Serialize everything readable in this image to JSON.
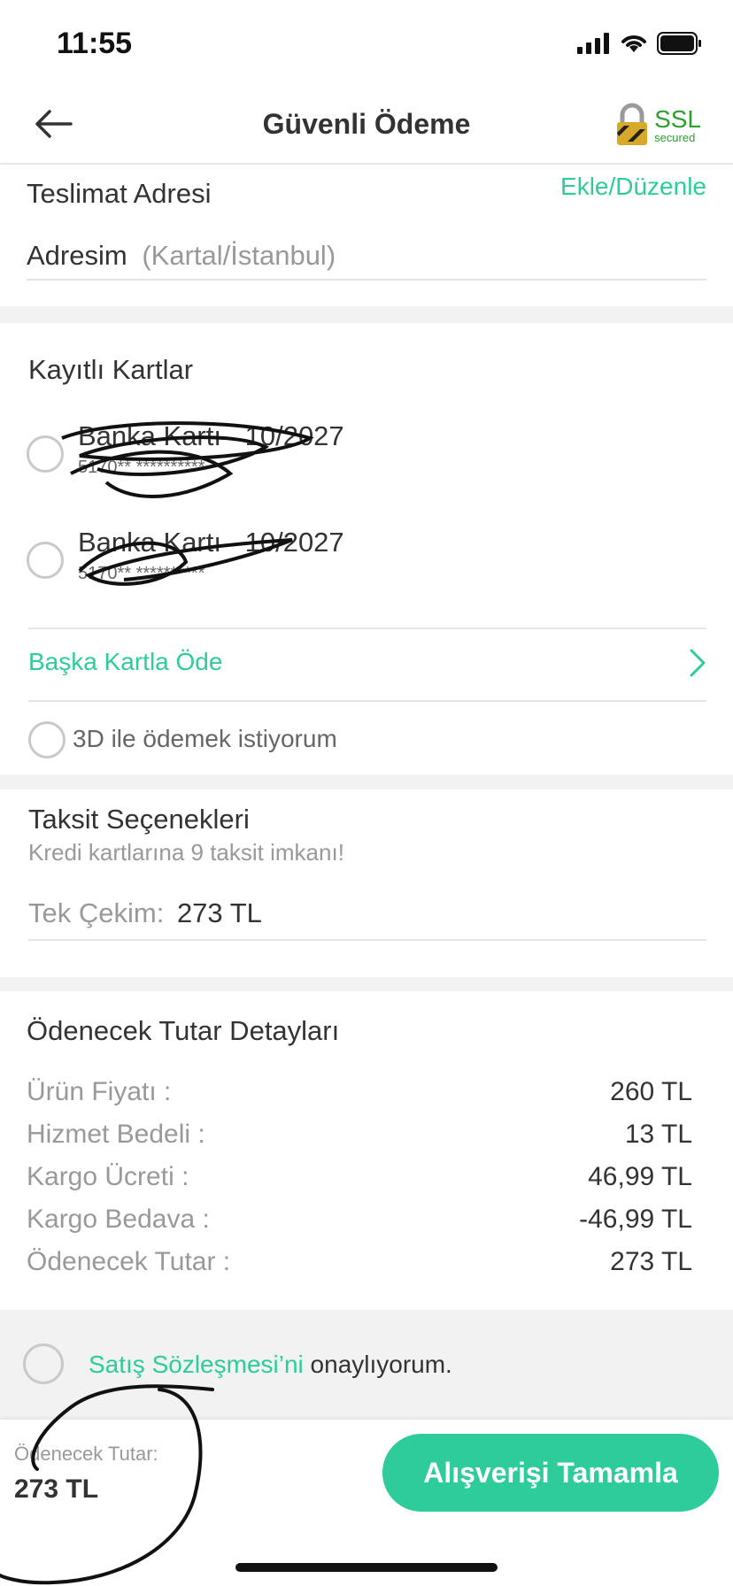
{
  "status": {
    "time": "11:55"
  },
  "nav": {
    "title": "Güvenli Ödeme",
    "ssl_label": "SSL",
    "ssl_sub": "secured"
  },
  "address": {
    "title": "Teslimat Adresi",
    "edit_link": "Ekle/Düzenle",
    "name": "Adresim",
    "location": "(Kartal/İstanbul)"
  },
  "cards": {
    "title": "Kayıtlı Kartlar",
    "items": [
      {
        "label": "Banka Kartı",
        "expiry": "10/2027",
        "number": "5170** **********"
      },
      {
        "label": "Banka Kartı",
        "expiry": "10/2027",
        "number": "5170** **********"
      }
    ],
    "other_card": "Başka Kartla Öde",
    "three_d": "3D ile ödemek istiyorum"
  },
  "installments": {
    "title": "Taksit Seçenekleri",
    "subtitle": "Kredi kartlarına 9 taksit imkanı!",
    "single_label": "Tek Çekim:",
    "single_value": "273 TL"
  },
  "summary": {
    "title": "Ödenecek Tutar Detayları",
    "rows": [
      {
        "label": "Ürün Fiyatı :",
        "value": "260 TL"
      },
      {
        "label": "Hizmet Bedeli :",
        "value": "13 TL"
      },
      {
        "label": "Kargo Ücreti :",
        "value": "46,99 TL"
      },
      {
        "label": "Kargo Bedava :",
        "value": "-46,99 TL"
      },
      {
        "label": "Ödenecek Tutar :",
        "value": "273 TL"
      }
    ]
  },
  "agreement": {
    "link": "Satış Sözleşmesi’ni",
    "text": " onaylıyorum."
  },
  "footer": {
    "total_label": "Ödenecek Tutar:",
    "total_value": "273 TL",
    "button": "Alışverişi Tamamla"
  },
  "colors": {
    "accent": "#2ecc9a",
    "ssl_green": "#2da02d"
  }
}
